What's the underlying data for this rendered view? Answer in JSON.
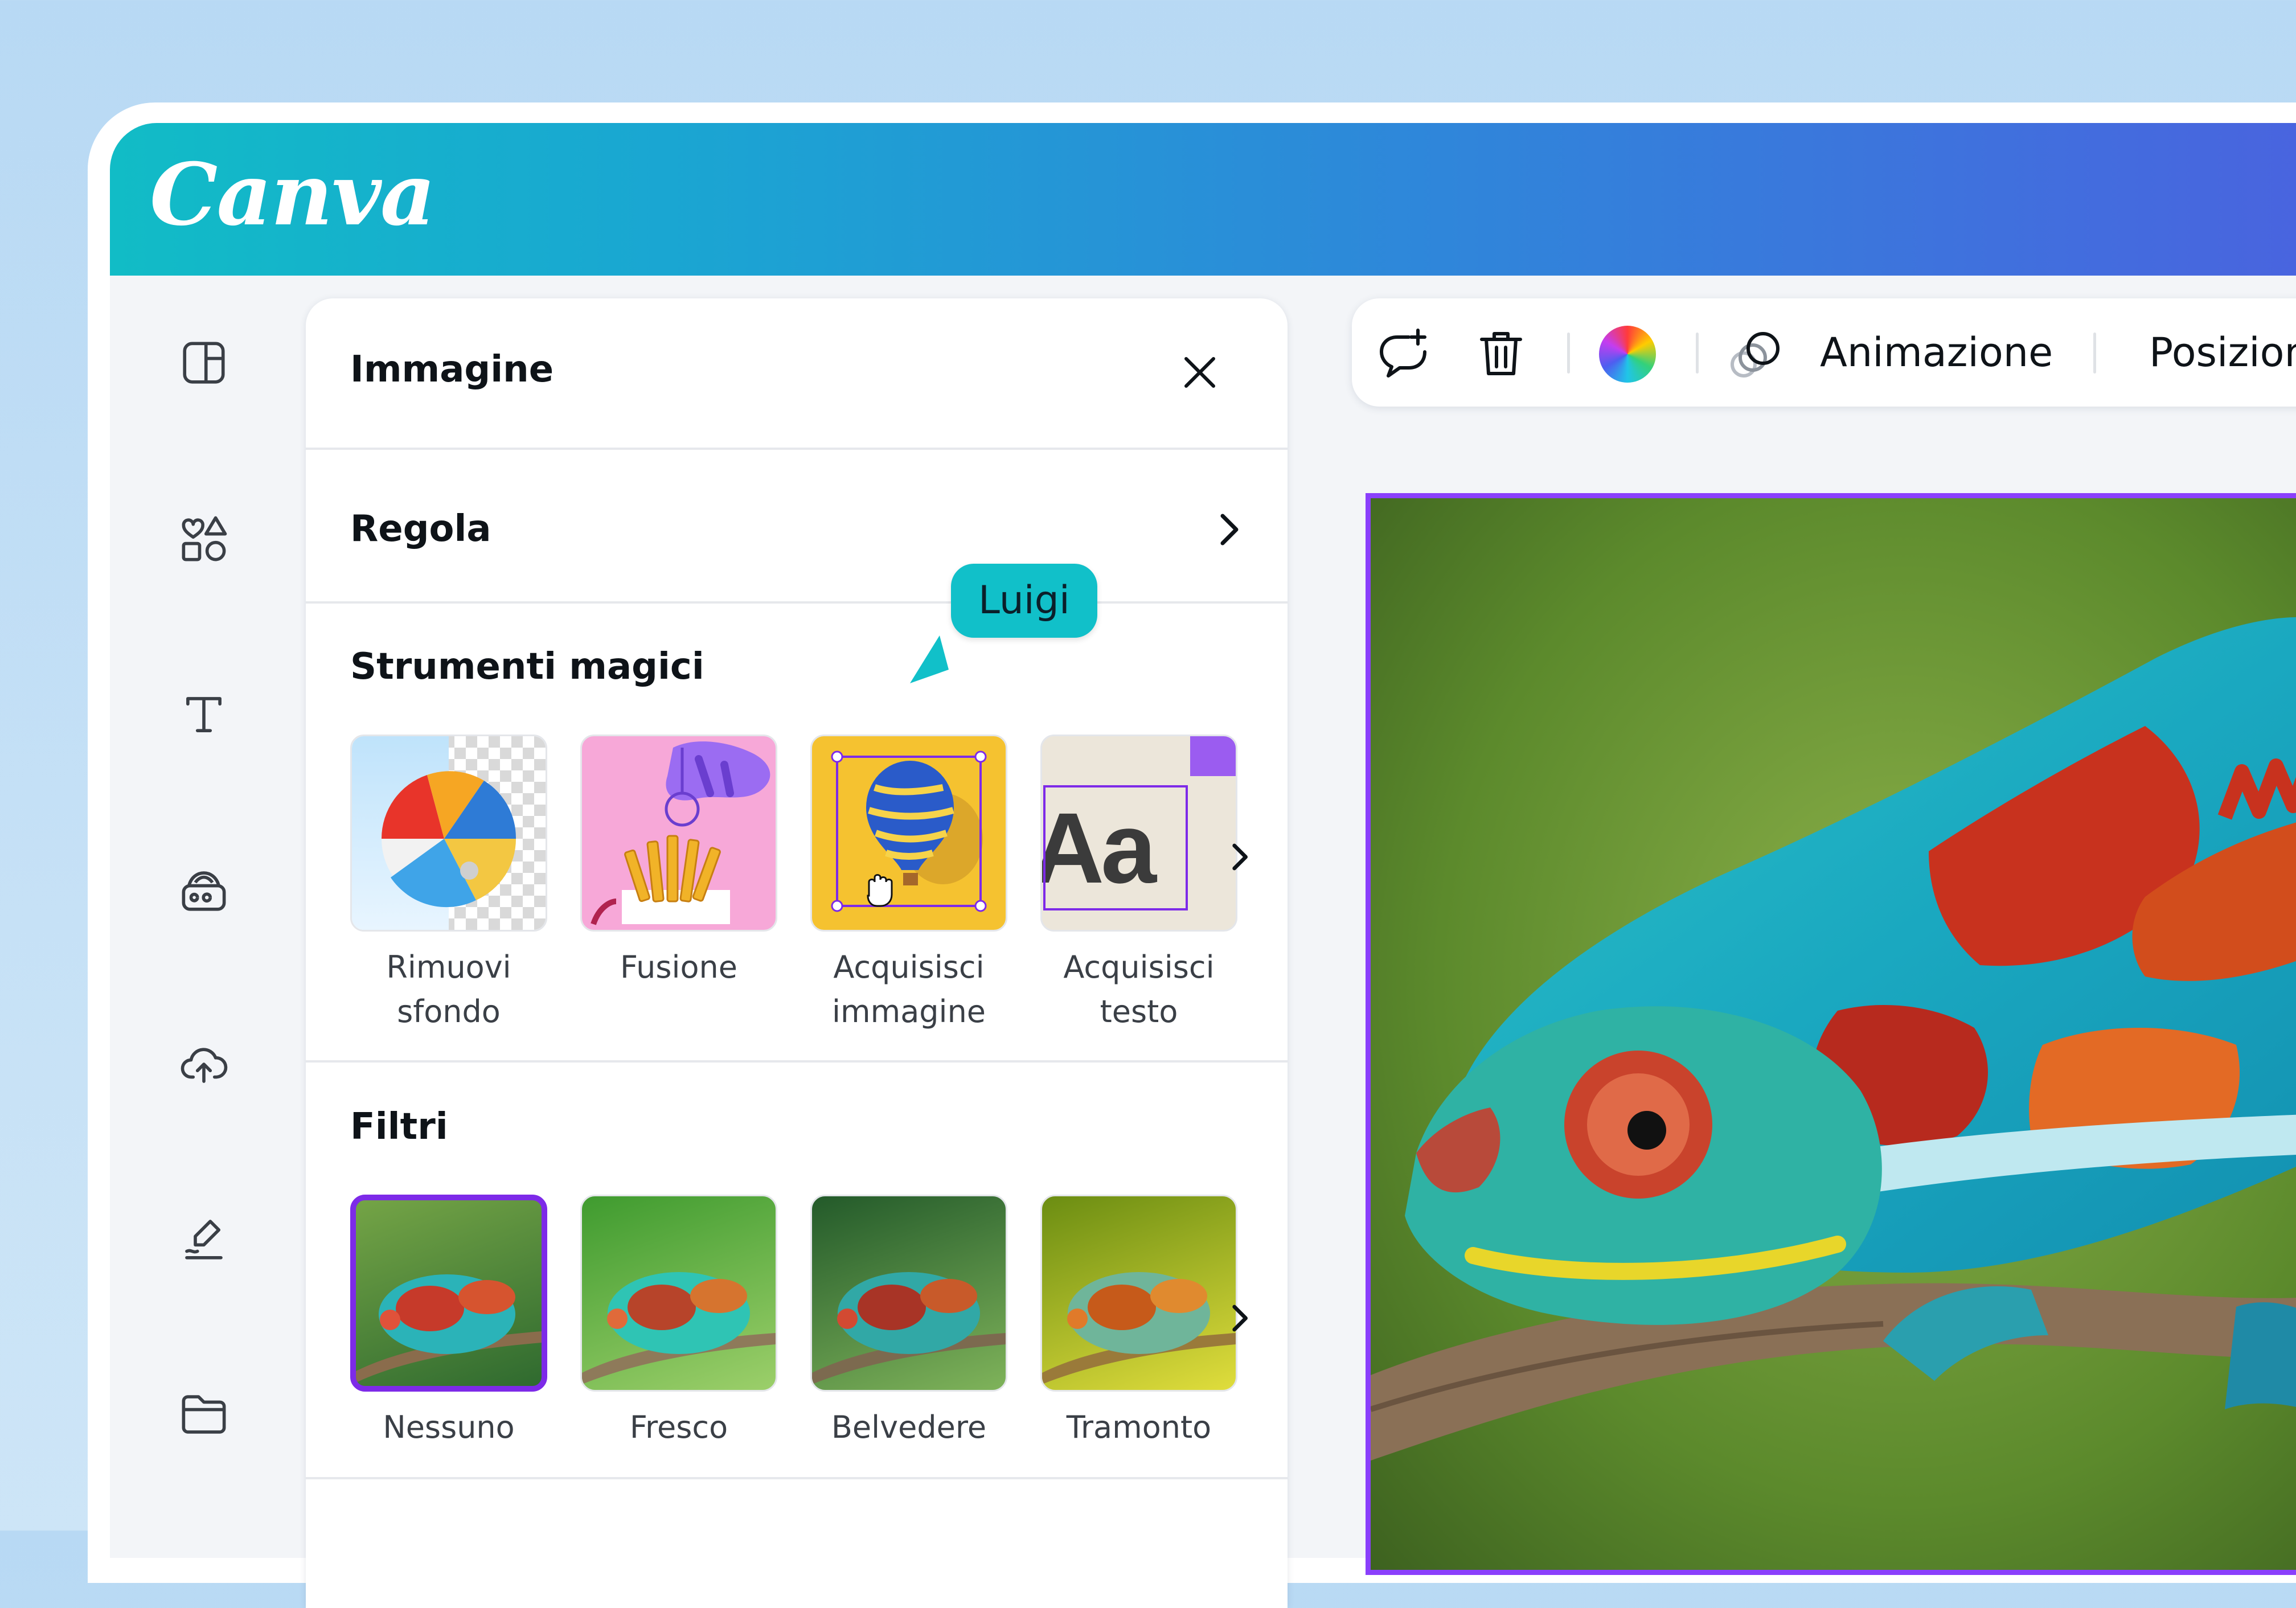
{
  "app": {
    "logo": "Canva"
  },
  "sidebar": {
    "items": [
      {
        "icon": "layout-icon"
      },
      {
        "icon": "elements-icon"
      },
      {
        "icon": "text-icon"
      },
      {
        "icon": "brand-icon"
      },
      {
        "icon": "upload-icon"
      },
      {
        "icon": "draw-icon"
      },
      {
        "icon": "folder-icon"
      }
    ]
  },
  "panel": {
    "title": "Immagine",
    "regola": "Regola",
    "magic_tools": {
      "title": "Strumenti magici",
      "items": [
        {
          "line1": "Rimuovi",
          "line2": "sfondo"
        },
        {
          "line1": "Fusione",
          "line2": ""
        },
        {
          "line1": "Acquisisci",
          "line2": "immagine"
        },
        {
          "line1": "Acquisisci",
          "line2": "testo"
        }
      ],
      "thumb_text": "Aa"
    },
    "filters": {
      "title": "Filtri",
      "items": [
        {
          "label": "Nessuno",
          "selected": true
        },
        {
          "label": "Fresco",
          "selected": false
        },
        {
          "label": "Belvedere",
          "selected": false
        },
        {
          "label": "Tramonto",
          "selected": false
        }
      ]
    }
  },
  "collaborator": {
    "name": "Luigi",
    "color": "#11c0c9"
  },
  "toolbar": {
    "animation_label": "Animazione",
    "position_label": "Posizion"
  },
  "colors": {
    "accent": "#7d2ae8",
    "selection": "#8a3ffc"
  }
}
